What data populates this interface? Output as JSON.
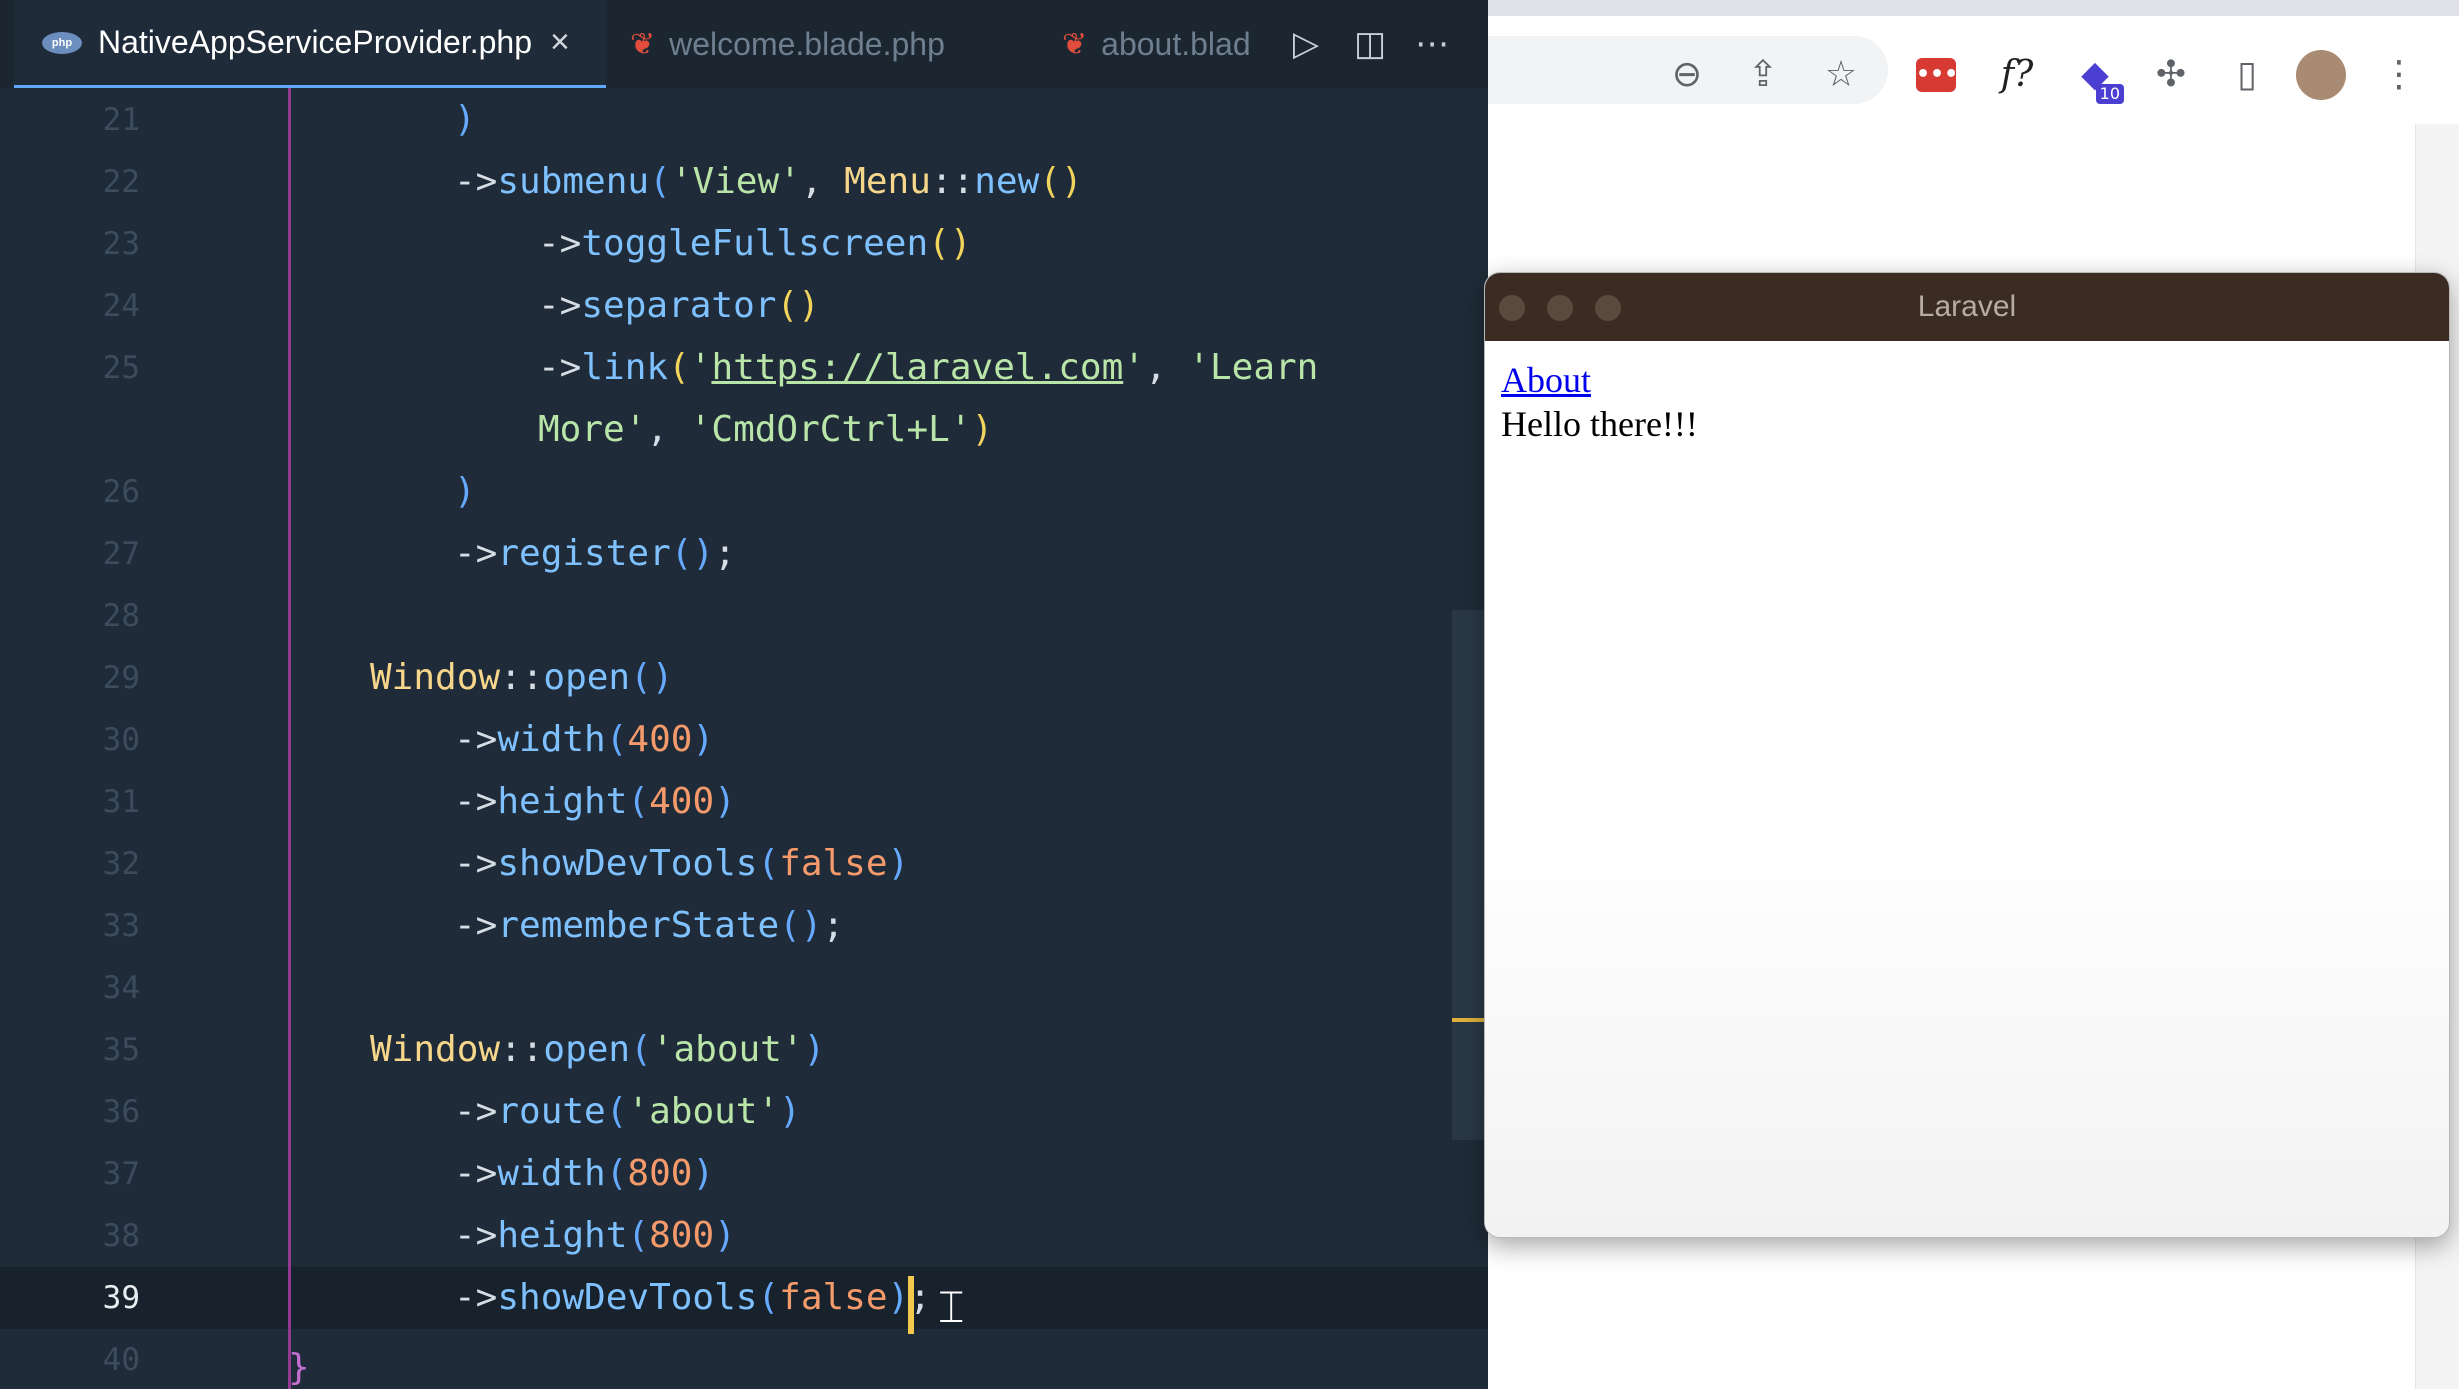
{
  "editor": {
    "tabs": [
      {
        "label": "NativeAppServiceProvider.php",
        "active": true,
        "icon": "php-icon"
      },
      {
        "label": "welcome.blade.php",
        "active": false,
        "icon": "laravel-icon"
      },
      {
        "label": "about.blad",
        "active": false,
        "icon": "laravel-icon"
      }
    ],
    "php_badge": "php",
    "close_glyph": "×",
    "actions": [
      "run-icon",
      "split-editor-icon",
      "more-actions-icon"
    ],
    "current_line": 39,
    "lines": [
      {
        "n": "21",
        "indent": 1,
        "tokens": [
          {
            "t": ")",
            "c": "t-paren2"
          }
        ]
      },
      {
        "n": "22",
        "indent": 1,
        "tokens": [
          {
            "t": "->",
            "c": "t-op"
          },
          {
            "t": "submenu",
            "c": "t-fn"
          },
          {
            "t": "(",
            "c": "t-paren2"
          },
          {
            "t": "'View'",
            "c": "t-str"
          },
          {
            "t": ", ",
            "c": "t-op"
          },
          {
            "t": "Menu",
            "c": "t-cls"
          },
          {
            "t": "::",
            "c": "t-op"
          },
          {
            "t": "new",
            "c": "t-fn"
          },
          {
            "t": "()",
            "c": "t-paren"
          }
        ]
      },
      {
        "n": "23",
        "indent": 2,
        "tokens": [
          {
            "t": "->",
            "c": "t-op"
          },
          {
            "t": "toggleFullscreen",
            "c": "t-fn"
          },
          {
            "t": "()",
            "c": "t-paren"
          }
        ]
      },
      {
        "n": "24",
        "indent": 2,
        "tokens": [
          {
            "t": "->",
            "c": "t-op"
          },
          {
            "t": "separator",
            "c": "t-fn"
          },
          {
            "t": "()",
            "c": "t-paren"
          }
        ]
      },
      {
        "n": "25",
        "indent": 2,
        "tokens": [
          {
            "t": "->",
            "c": "t-op"
          },
          {
            "t": "link",
            "c": "t-fn"
          },
          {
            "t": "(",
            "c": "t-paren"
          },
          {
            "t": "'",
            "c": "t-str"
          },
          {
            "t": "https://laravel.com",
            "c": "t-url"
          },
          {
            "t": "'",
            "c": "t-str"
          },
          {
            "t": ", ",
            "c": "t-op"
          },
          {
            "t": "'Learn",
            "c": "t-str"
          }
        ]
      },
      {
        "n": "",
        "indent": 2,
        "tokens": [
          {
            "t": "More'",
            "c": "t-str"
          },
          {
            "t": ", ",
            "c": "t-op"
          },
          {
            "t": "'CmdOrCtrl+L'",
            "c": "t-str"
          },
          {
            "t": ")",
            "c": "t-paren"
          }
        ]
      },
      {
        "n": "26",
        "indent": 1,
        "tokens": [
          {
            "t": ")",
            "c": "t-paren2"
          }
        ]
      },
      {
        "n": "27",
        "indent": 1,
        "tokens": [
          {
            "t": "->",
            "c": "t-op"
          },
          {
            "t": "register",
            "c": "t-fn"
          },
          {
            "t": "()",
            "c": "t-paren2"
          },
          {
            "t": ";",
            "c": "t-op"
          }
        ]
      },
      {
        "n": "28",
        "indent": 0,
        "tokens": []
      },
      {
        "n": "29",
        "indent": 0,
        "tokens": [
          {
            "t": "Window",
            "c": "t-cls"
          },
          {
            "t": "::",
            "c": "t-op"
          },
          {
            "t": "open",
            "c": "t-fn"
          },
          {
            "t": "()",
            "c": "t-paren2"
          }
        ]
      },
      {
        "n": "30",
        "indent": 1,
        "tokens": [
          {
            "t": "->",
            "c": "t-op"
          },
          {
            "t": "width",
            "c": "t-fn"
          },
          {
            "t": "(",
            "c": "t-paren2"
          },
          {
            "t": "400",
            "c": "t-num"
          },
          {
            "t": ")",
            "c": "t-paren2"
          }
        ]
      },
      {
        "n": "31",
        "indent": 1,
        "tokens": [
          {
            "t": "->",
            "c": "t-op"
          },
          {
            "t": "height",
            "c": "t-fn"
          },
          {
            "t": "(",
            "c": "t-paren2"
          },
          {
            "t": "400",
            "c": "t-num"
          },
          {
            "t": ")",
            "c": "t-paren2"
          }
        ]
      },
      {
        "n": "32",
        "indent": 1,
        "tokens": [
          {
            "t": "->",
            "c": "t-op"
          },
          {
            "t": "showDevTools",
            "c": "t-fn"
          },
          {
            "t": "(",
            "c": "t-paren2"
          },
          {
            "t": "false",
            "c": "t-bool"
          },
          {
            "t": ")",
            "c": "t-paren2"
          }
        ]
      },
      {
        "n": "33",
        "indent": 1,
        "tokens": [
          {
            "t": "->",
            "c": "t-op"
          },
          {
            "t": "rememberState",
            "c": "t-fn"
          },
          {
            "t": "()",
            "c": "t-paren2"
          },
          {
            "t": ";",
            "c": "t-op"
          }
        ]
      },
      {
        "n": "34",
        "indent": 0,
        "tokens": []
      },
      {
        "n": "35",
        "indent": 0,
        "tokens": [
          {
            "t": "Window",
            "c": "t-cls"
          },
          {
            "t": "::",
            "c": "t-op"
          },
          {
            "t": "open",
            "c": "t-fn"
          },
          {
            "t": "(",
            "c": "t-paren2"
          },
          {
            "t": "'about'",
            "c": "t-str"
          },
          {
            "t": ")",
            "c": "t-paren2"
          }
        ]
      },
      {
        "n": "36",
        "indent": 1,
        "tokens": [
          {
            "t": "->",
            "c": "t-op"
          },
          {
            "t": "route",
            "c": "t-fn"
          },
          {
            "t": "(",
            "c": "t-paren2"
          },
          {
            "t": "'about'",
            "c": "t-str"
          },
          {
            "t": ")",
            "c": "t-paren2"
          }
        ]
      },
      {
        "n": "37",
        "indent": 1,
        "tokens": [
          {
            "t": "->",
            "c": "t-op"
          },
          {
            "t": "width",
            "c": "t-fn"
          },
          {
            "t": "(",
            "c": "t-paren2"
          },
          {
            "t": "800",
            "c": "t-num"
          },
          {
            "t": ")",
            "c": "t-paren2"
          }
        ]
      },
      {
        "n": "38",
        "indent": 1,
        "tokens": [
          {
            "t": "->",
            "c": "t-op"
          },
          {
            "t": "height",
            "c": "t-fn"
          },
          {
            "t": "(",
            "c": "t-paren2"
          },
          {
            "t": "800",
            "c": "t-num"
          },
          {
            "t": ")",
            "c": "t-paren2"
          }
        ]
      },
      {
        "n": "39",
        "indent": 1,
        "tokens": [
          {
            "t": "->",
            "c": "t-op"
          },
          {
            "t": "showDevTools",
            "c": "t-fn"
          },
          {
            "t": "(",
            "c": "t-paren2"
          },
          {
            "t": "false",
            "c": "t-bool"
          },
          {
            "t": ")",
            "c": "t-paren2"
          },
          {
            "t": ";",
            "c": "t-op"
          }
        ]
      },
      {
        "n": "40",
        "indent": 0,
        "tokens": []
      }
    ],
    "closing_brace": "}",
    "colors": {
      "background": "#1f2b38",
      "accent": "#5fa8ff",
      "string": "#b9e5a8",
      "number": "#f59a6a",
      "function": "#7fc1ff",
      "class": "#f5d68a"
    }
  },
  "browser": {
    "toolbar_icons": [
      "zoom-out-icon",
      "share-icon",
      "bookmark-star-icon",
      "lastpass-extension-icon",
      "f-extension-icon",
      "graduation-cap-extension-icon",
      "extensions-puzzle-icon",
      "side-panel-icon",
      "profile-avatar",
      "menu-kebab-icon"
    ],
    "f_extension_label": "f?",
    "badge_count": "10"
  },
  "app_window": {
    "title": "Laravel",
    "link_label": "About",
    "body_text": "Hello there!!!"
  }
}
